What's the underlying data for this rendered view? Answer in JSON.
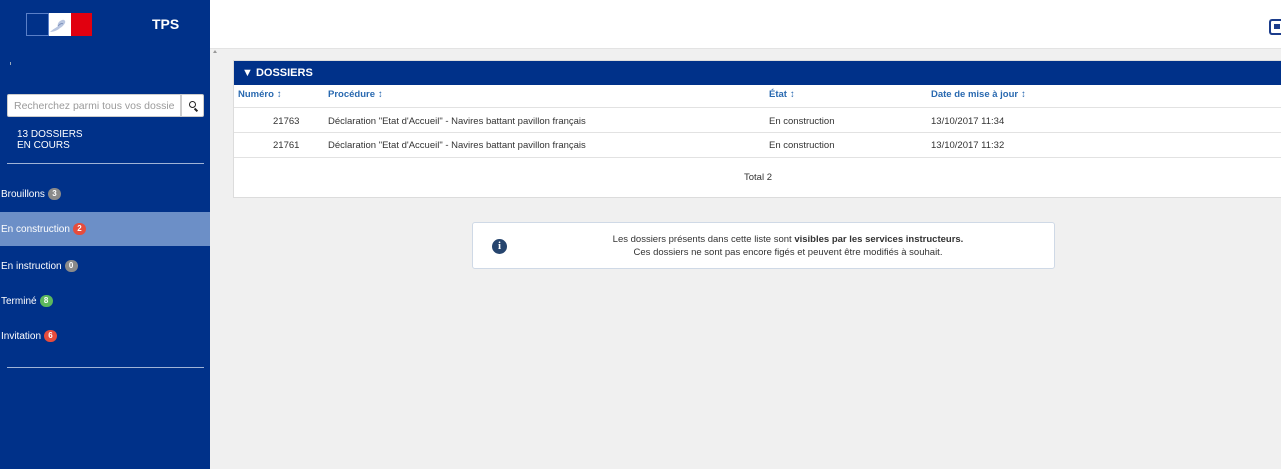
{
  "header": {
    "app_title": "TPS"
  },
  "sidebar": {
    "search_placeholder": "Recherchez parmi tous vos dossiers",
    "count_line1": "13 DOSSIERS",
    "count_line2": "EN COURS",
    "items": [
      {
        "label": "Brouillons",
        "count": "3",
        "badge_color": "#8a8a8a",
        "active": false
      },
      {
        "label": "En construction",
        "count": "2",
        "badge_color": "#e74c3c",
        "active": true
      },
      {
        "label": "En instruction",
        "count": "0",
        "badge_color": "#8a8a8a",
        "active": false
      },
      {
        "label": "Terminé",
        "count": "8",
        "badge_color": "#5cb85c",
        "active": false
      },
      {
        "label": "Invitation",
        "count": "6",
        "badge_color": "#e74c3c",
        "active": false
      }
    ]
  },
  "dossiers": {
    "title": "▼ DOSSIERS",
    "columns": [
      "Numéro",
      "Procédure",
      "État",
      "Date de mise à jour"
    ],
    "rows": [
      {
        "numero": "21763",
        "procedure": "Déclaration \"Etat d'Accueil\" - Navires battant pavillon français",
        "etat": "En construction",
        "date": "13/10/2017 11:34"
      },
      {
        "numero": "21761",
        "procedure": "Déclaration \"Etat d'Accueil\" - Navires battant pavillon français",
        "etat": "En construction",
        "date": "13/10/2017 11:32"
      }
    ],
    "total": "Total 2"
  },
  "info": {
    "line1_prefix": "Les dossiers présents dans cette liste sont ",
    "line1_bold": "visibles par les services instructeurs.",
    "line2": "Ces dossiers ne sont pas encore figés et peuvent être modifiés à souhait."
  },
  "colors": {
    "brand_blue": "#003189",
    "active_item": "#6c8fc7",
    "link_blue": "#2969b0"
  }
}
